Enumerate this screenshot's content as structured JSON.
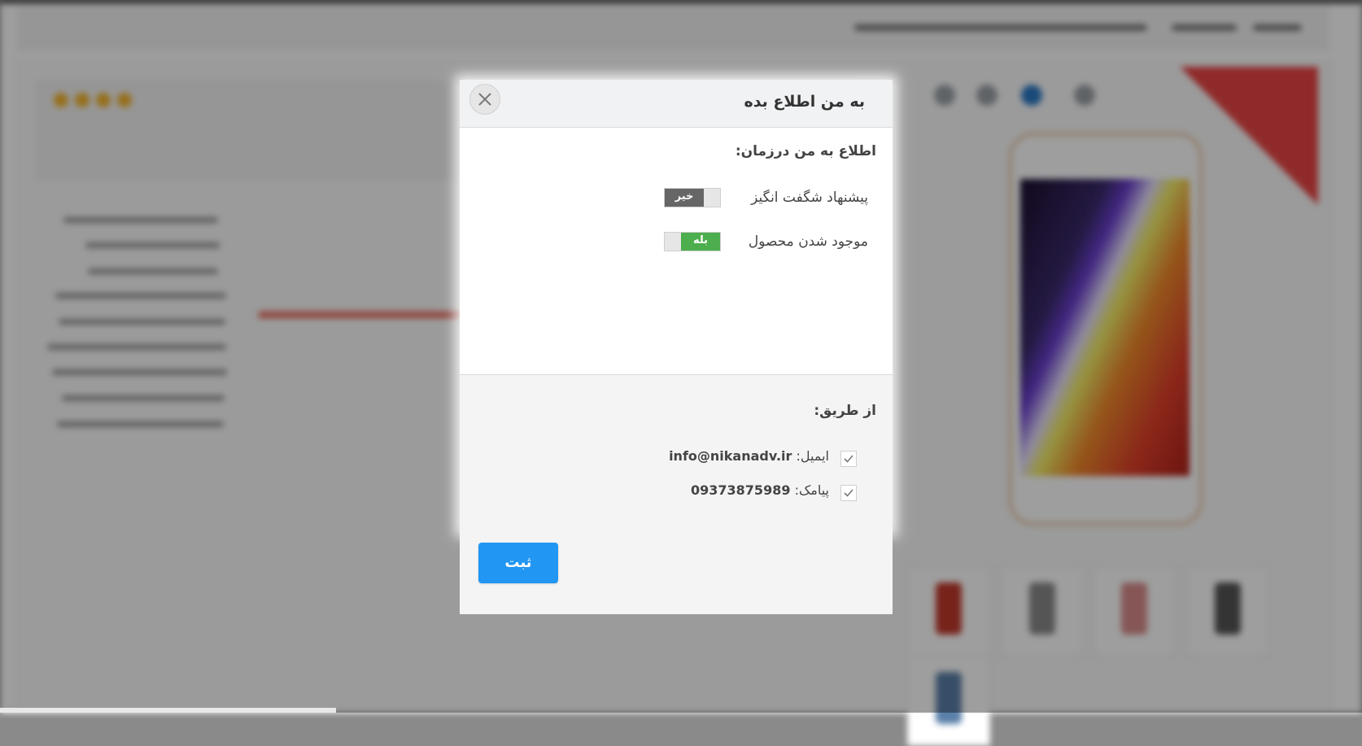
{
  "modal": {
    "title": "به من اطلاع بده",
    "close_icon": "close-icon",
    "when_section": {
      "heading": "اطلاع به من  درزمان:",
      "options": [
        {
          "label": "پیشنهاد شگفت انگیز",
          "state_text": "خیر",
          "enabled": false
        },
        {
          "label": "موجود شدن محصول",
          "state_text": "بله",
          "enabled": true
        }
      ]
    },
    "via_section": {
      "heading": "از طریق:",
      "channels": [
        {
          "label": "ایمیل:",
          "value": "info@nikanadv.ir",
          "checked": true
        },
        {
          "label": "پیامک:",
          "value": "09373875989",
          "checked": true
        }
      ]
    },
    "submit_label": "ثبت"
  },
  "colors": {
    "submit": "#2196f3",
    "toggle_on": "#4cae4c",
    "toggle_off": "#666666",
    "header_bg": "#f1f2f3"
  }
}
